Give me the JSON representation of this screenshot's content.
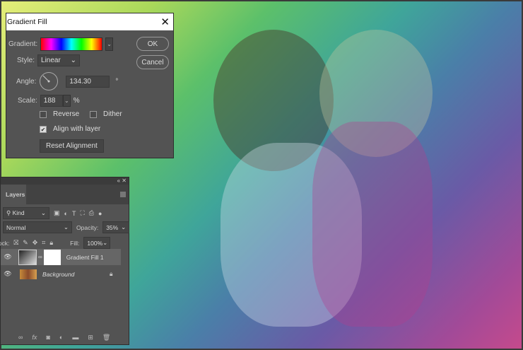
{
  "dialog": {
    "title": "Gradient Fill",
    "gradient_label": "Gradient:",
    "style_label": "Style:",
    "style_value": "Linear",
    "angle_label": "Angle:",
    "angle_value": "134.30",
    "degree_symbol": "°",
    "scale_label": "Scale:",
    "scale_value": "188",
    "percent_symbol": "%",
    "reverse_label": "Reverse",
    "reverse_checked": false,
    "dither_label": "Dither",
    "dither_checked": false,
    "align_label": "Align with layer",
    "align_checked": true,
    "reset_label": "Reset Alignment",
    "ok_label": "OK",
    "cancel_label": "Cancel"
  },
  "layers": {
    "collapse": "«",
    "close": "✕",
    "tab": "Layers",
    "filter": "Kind",
    "blend_mode": "Normal",
    "opacity_label": "Opacity:",
    "opacity_value": "35%",
    "lock_label": "Lock:",
    "fill_label": "Fill:",
    "fill_value": "100%",
    "items": [
      {
        "name": "Gradient Fill 1",
        "selected": true
      },
      {
        "name": "Background",
        "locked": true
      }
    ]
  }
}
